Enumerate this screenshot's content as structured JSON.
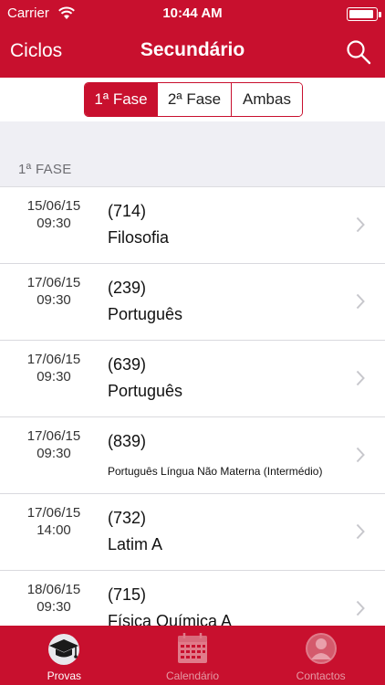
{
  "status_bar": {
    "carrier": "Carrier",
    "time": "10:44 AM",
    "battery_level": 0.95
  },
  "nav": {
    "back_label": "Ciclos",
    "title": "Secundário",
    "search_icon": "search-icon"
  },
  "segments": [
    {
      "label": "1ª Fase",
      "active": true
    },
    {
      "label": "2ª Fase",
      "active": false
    },
    {
      "label": "Ambas",
      "active": false
    }
  ],
  "section": {
    "label": "1ª FASE"
  },
  "exams": [
    {
      "date": "15/06/15",
      "time": "09:30",
      "code": "(714)",
      "name": "Filosofia",
      "small": false
    },
    {
      "date": "17/06/15",
      "time": "09:30",
      "code": "(239)",
      "name": "Português",
      "small": false
    },
    {
      "date": "17/06/15",
      "time": "09:30",
      "code": "(639)",
      "name": "Português",
      "small": false
    },
    {
      "date": "17/06/15",
      "time": "09:30",
      "code": "(839)",
      "name": "Português Língua Não Materna (Intermédio)",
      "small": true
    },
    {
      "date": "17/06/15",
      "time": "14:00",
      "code": "(732)",
      "name": "Latim A",
      "small": false
    },
    {
      "date": "18/06/15",
      "time": "09:30",
      "code": "(715)",
      "name": "Física Química A",
      "small": false
    }
  ],
  "tabs": [
    {
      "label": "Provas",
      "icon": "graduation-cap-icon",
      "active": true
    },
    {
      "label": "Calendário",
      "icon": "calendar-icon",
      "active": false
    },
    {
      "label": "Contactos",
      "icon": "contact-person-icon",
      "active": false
    }
  ],
  "colors": {
    "brand": "#c8102e",
    "tab_inactive": "#e59aa5",
    "section_bg": "#efeff4"
  }
}
